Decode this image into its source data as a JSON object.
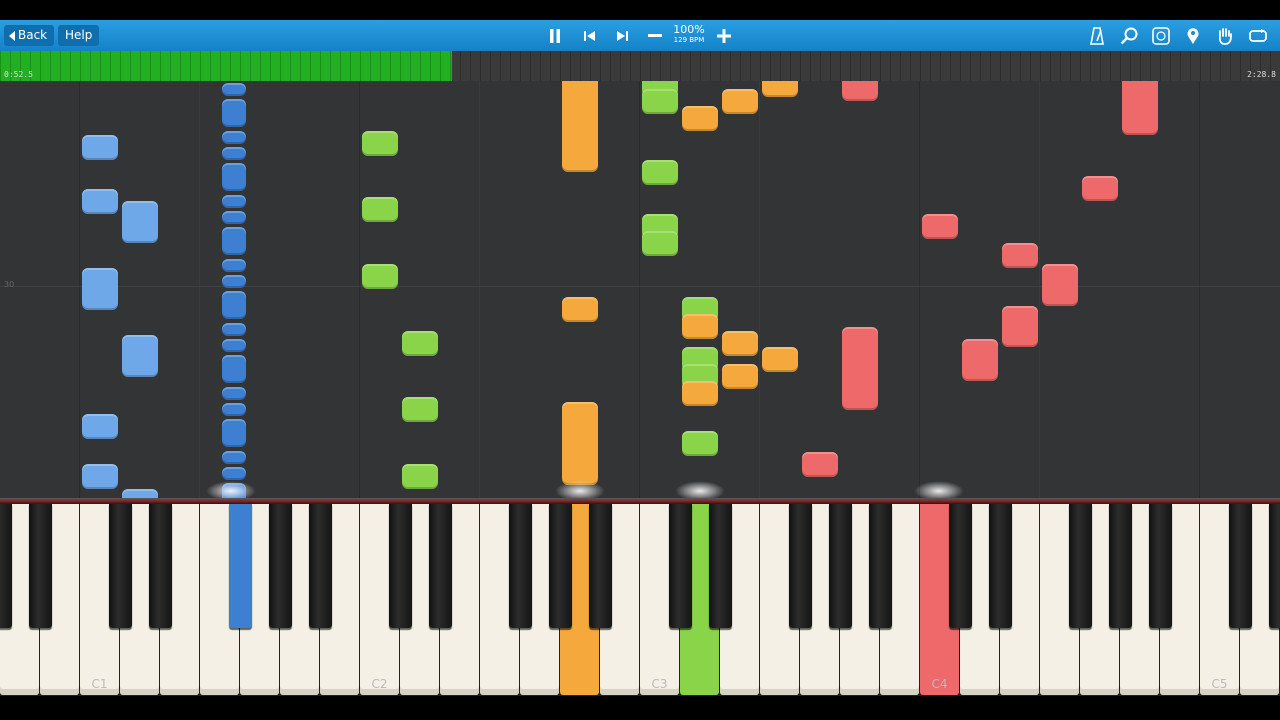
{
  "toolbar": {
    "back_label": "Back",
    "help_label": "Help",
    "speed_percent": "100%",
    "tempo": "129 BPM",
    "icons": [
      "pause-icon",
      "skip-back-icon",
      "skip-forward-icon",
      "minus-icon",
      "plus-icon",
      "metronome-icon",
      "search-icon",
      "key-label-icon",
      "location-pin-icon",
      "hand-icon",
      "loop-icon"
    ]
  },
  "progress": {
    "elapsed": "0:52.5",
    "total": "2:28.8",
    "fraction": 0.353,
    "color": "#22b022"
  },
  "roll": {
    "measure_number": "30",
    "track_colors": {
      "blue": "#6ea8e8",
      "green": "#8ad44a",
      "orange": "#f5a93c",
      "red": "#ee6a6a",
      "darkblue": "#3d7fd0"
    },
    "notes": [
      {
        "track": "blue",
        "key": 2,
        "t": 0.29,
        "d": 0.06
      },
      {
        "track": "blue",
        "key": 2,
        "t": 0.16,
        "d": 0.06
      },
      {
        "track": "blue",
        "key": 3,
        "t": 0.36,
        "d": 0.1
      },
      {
        "track": "blue",
        "key": 2,
        "t": 0.52,
        "d": 0.1
      },
      {
        "track": "blue",
        "key": 3,
        "t": 0.68,
        "d": 0.1
      },
      {
        "track": "blue",
        "key": 2,
        "t": 0.83,
        "d": 0.06
      },
      {
        "track": "blue",
        "key": 2,
        "t": 0.95,
        "d": 0.06
      },
      {
        "track": "blue",
        "key": 3,
        "t": 1.05,
        "d": 0.1
      },
      {
        "track": "green",
        "key": 9,
        "t": 0.15,
        "d": 0.06
      },
      {
        "track": "green",
        "key": 9,
        "t": 0.31,
        "d": 0.06
      },
      {
        "track": "green",
        "key": 9,
        "t": 0.47,
        "d": 0.06
      },
      {
        "track": "green",
        "key": 10,
        "t": 0.63,
        "d": 0.06
      },
      {
        "track": "green",
        "key": 10,
        "t": 0.79,
        "d": 0.06
      },
      {
        "track": "green",
        "key": 10,
        "t": 0.95,
        "d": 0.06
      },
      {
        "track": "orange",
        "key": 14,
        "t": 0.19,
        "d": 0.46
      },
      {
        "track": "orange",
        "key": 14,
        "t": 0.55,
        "d": 0.06
      },
      {
        "track": "orange",
        "key": 14,
        "t": 0.94,
        "d": 0.2
      },
      {
        "track": "green",
        "key": 16,
        "t": 0.01,
        "d": 0.06
      },
      {
        "track": "green",
        "key": 16,
        "t": 0.05,
        "d": 0.06
      },
      {
        "track": "green",
        "key": 16,
        "t": 0.22,
        "d": 0.06
      },
      {
        "track": "green",
        "key": 16,
        "t": 0.35,
        "d": 0.06
      },
      {
        "track": "green",
        "key": 16,
        "t": 0.39,
        "d": 0.06
      },
      {
        "track": "green",
        "key": 17,
        "t": 0.55,
        "d": 0.06
      },
      {
        "track": "green",
        "key": 17,
        "t": 0.67,
        "d": 0.06
      },
      {
        "track": "green",
        "key": 17,
        "t": 0.71,
        "d": 0.06
      },
      {
        "track": "green",
        "key": 17,
        "t": 0.87,
        "d": 0.06
      },
      {
        "track": "orange",
        "key": 17,
        "t": 0.09,
        "d": 0.06
      },
      {
        "track": "orange",
        "key": 17,
        "t": 0.59,
        "d": 0.06
      },
      {
        "track": "orange",
        "key": 17,
        "t": 0.75,
        "d": 0.06
      },
      {
        "track": "orange",
        "key": 18,
        "t": 0.05,
        "d": 0.06
      },
      {
        "track": "orange",
        "key": 18,
        "t": 0.63,
        "d": 0.06
      },
      {
        "track": "orange",
        "key": 18,
        "t": 0.71,
        "d": 0.06
      },
      {
        "track": "orange",
        "key": 19,
        "t": 0.01,
        "d": 0.06
      },
      {
        "track": "orange",
        "key": 19,
        "t": 0.67,
        "d": 0.06
      },
      {
        "track": "red",
        "key": 21,
        "t": 0.02,
        "d": 0.1
      },
      {
        "track": "red",
        "key": 21,
        "t": 0.76,
        "d": 0.2
      },
      {
        "track": "red",
        "key": 20,
        "t": 0.92,
        "d": 0.06
      },
      {
        "track": "red",
        "key": 23,
        "t": 0.35,
        "d": 0.06
      },
      {
        "track": "red",
        "key": 25,
        "t": 0.42,
        "d": 0.06
      },
      {
        "track": "red",
        "key": 26,
        "t": 0.47,
        "d": 0.06
      },
      {
        "track": "red",
        "key": 26,
        "t": 0.51,
        "d": 0.1
      },
      {
        "track": "red",
        "key": 25,
        "t": 0.61,
        "d": 0.1
      },
      {
        "track": "red",
        "key": 24,
        "t": 0.69,
        "d": 0.1
      },
      {
        "track": "red",
        "key": 27,
        "t": 0.26,
        "d": 0.06
      },
      {
        "track": "red",
        "key": 28,
        "t": 0.1,
        "d": 0.2
      }
    ],
    "bass_column_key": 5
  },
  "keyboard": {
    "labels": [
      {
        "key": 2,
        "text": "C1"
      },
      {
        "key": 9,
        "text": "C2"
      },
      {
        "key": 16,
        "text": "C3"
      },
      {
        "key": 23,
        "text": "C4"
      },
      {
        "key": 30,
        "text": "C5"
      }
    ],
    "pressed": [
      {
        "type": "black",
        "slot": 5,
        "color": "#3d7fd0"
      },
      {
        "type": "white",
        "key": 14,
        "color": "#f5a93c"
      },
      {
        "type": "white",
        "key": 17,
        "color": "#8ad44a"
      },
      {
        "type": "white",
        "key": 23,
        "color": "#ee6a6a"
      }
    ]
  }
}
